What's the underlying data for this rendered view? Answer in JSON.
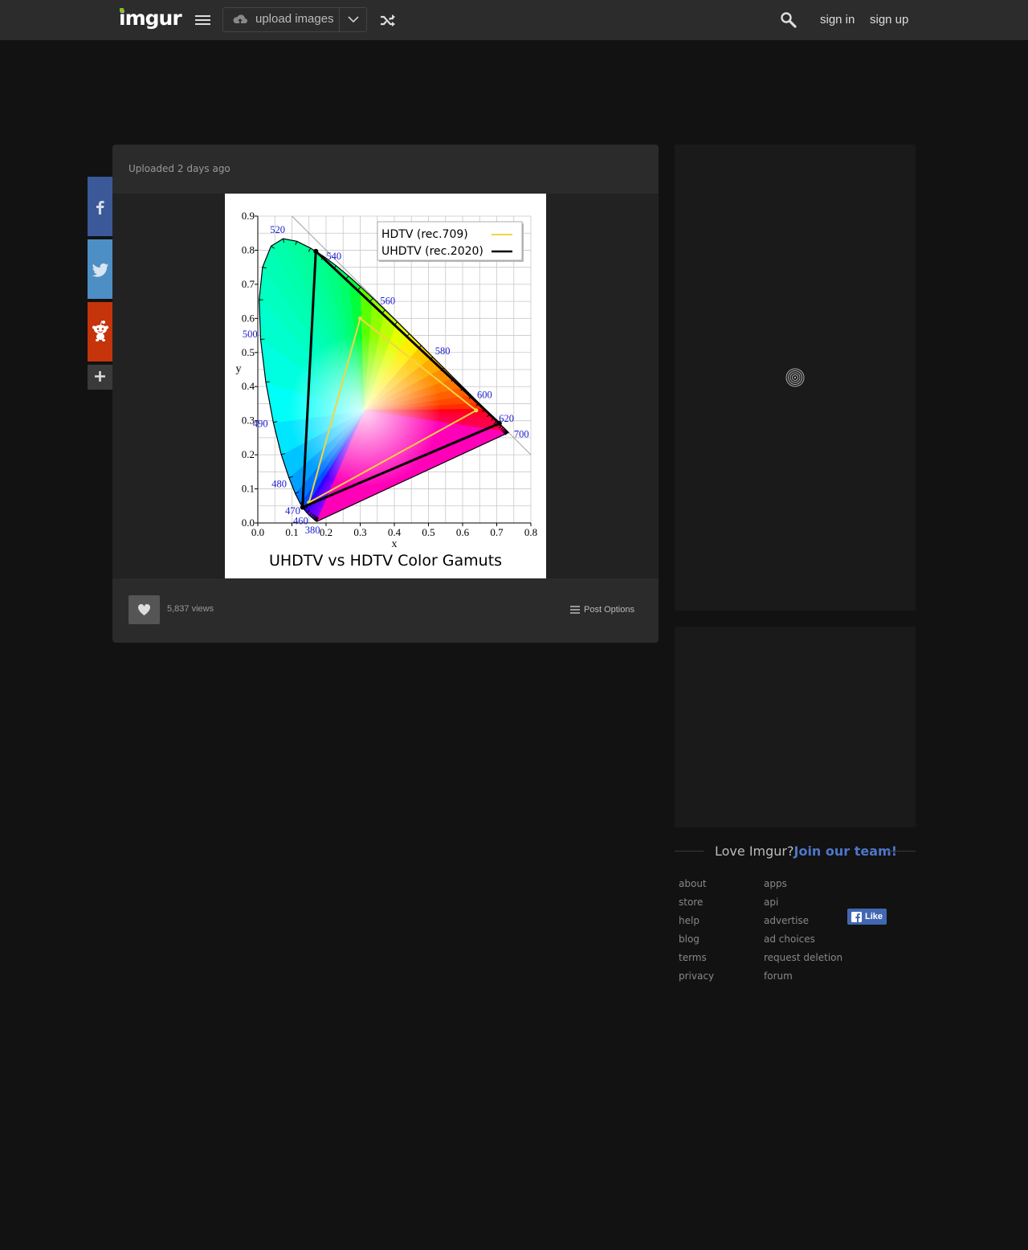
{
  "header": {
    "logo": "imgur",
    "upload_label": "upload images",
    "sign_in": "sign in",
    "sign_up": "sign up"
  },
  "post": {
    "uploaded_label": "Uploaded",
    "uploaded_time": "2 days ago",
    "views": "5,837 views",
    "post_options": "Post Options"
  },
  "chart_data": {
    "type": "scatter",
    "title": "UHDTV vs HDTV Color Gamuts",
    "xlabel": "x",
    "ylabel": "y",
    "xlim": [
      0.0,
      0.8
    ],
    "ylim": [
      0.0,
      0.9
    ],
    "xticks": [
      "0.0",
      "0.1",
      "0.2",
      "0.3",
      "0.4",
      "0.5",
      "0.6",
      "0.7",
      "0.8"
    ],
    "yticks": [
      "0.0",
      "0.1",
      "0.2",
      "0.3",
      "0.4",
      "0.5",
      "0.6",
      "0.7",
      "0.8",
      "0.9"
    ],
    "grid": true,
    "legend_position": "top-right",
    "series": [
      {
        "name": "HDTV (rec.709)",
        "color": "#f5d442",
        "x": [
          0.64,
          0.3,
          0.15,
          0.64
        ],
        "y": [
          0.33,
          0.6,
          0.06,
          0.33
        ]
      },
      {
        "name": "UHDTV (rec.2020)",
        "color": "#000000",
        "x": [
          0.708,
          0.17,
          0.131,
          0.708
        ],
        "y": [
          0.292,
          0.797,
          0.046,
          0.292
        ]
      }
    ],
    "wavelength_labels": [
      {
        "label": "380",
        "x": 0.175,
        "y": 0.005
      },
      {
        "label": "460",
        "x": 0.144,
        "y": 0.03
      },
      {
        "label": "470",
        "x": 0.124,
        "y": 0.058
      },
      {
        "label": "480",
        "x": 0.091,
        "y": 0.133
      },
      {
        "label": "490",
        "x": 0.045,
        "y": 0.295
      },
      {
        "label": "500",
        "x": 0.008,
        "y": 0.538
      },
      {
        "label": "520",
        "x": 0.074,
        "y": 0.834
      },
      {
        "label": "540",
        "x": 0.23,
        "y": 0.754
      },
      {
        "label": "560",
        "x": 0.373,
        "y": 0.624
      },
      {
        "label": "580",
        "x": 0.512,
        "y": 0.487
      },
      {
        "label": "600",
        "x": 0.627,
        "y": 0.372
      },
      {
        "label": "620",
        "x": 0.691,
        "y": 0.308
      },
      {
        "label": "700",
        "x": 0.735,
        "y": 0.265
      }
    ],
    "locus": [
      [
        0.1741,
        0.005
      ],
      [
        0.174,
        0.005
      ],
      [
        0.1738,
        0.0049
      ],
      [
        0.1736,
        0.0049
      ],
      [
        0.1733,
        0.0048
      ],
      [
        0.173,
        0.0048
      ],
      [
        0.1726,
        0.0048
      ],
      [
        0.1721,
        0.0048
      ],
      [
        0.1714,
        0.0051
      ],
      [
        0.1703,
        0.0058
      ],
      [
        0.1689,
        0.0069
      ],
      [
        0.1669,
        0.0086
      ],
      [
        0.1644,
        0.0109
      ],
      [
        0.1611,
        0.0138
      ],
      [
        0.1566,
        0.0177
      ],
      [
        0.151,
        0.0227
      ],
      [
        0.144,
        0.0297
      ],
      [
        0.1355,
        0.0399
      ],
      [
        0.1241,
        0.0578
      ],
      [
        0.1096,
        0.0868
      ],
      [
        0.0913,
        0.1327
      ],
      [
        0.0687,
        0.2007
      ],
      [
        0.0454,
        0.295
      ],
      [
        0.0235,
        0.4127
      ],
      [
        0.0082,
        0.5384
      ],
      [
        0.0039,
        0.6548
      ],
      [
        0.0139,
        0.7502
      ],
      [
        0.0389,
        0.812
      ],
      [
        0.0743,
        0.8338
      ],
      [
        0.1142,
        0.8262
      ],
      [
        0.1547,
        0.8059
      ],
      [
        0.1929,
        0.7816
      ],
      [
        0.2296,
        0.7543
      ],
      [
        0.2658,
        0.7243
      ],
      [
        0.3016,
        0.6923
      ],
      [
        0.3373,
        0.6589
      ],
      [
        0.3731,
        0.6245
      ],
      [
        0.4087,
        0.5896
      ],
      [
        0.4441,
        0.5547
      ],
      [
        0.4788,
        0.5202
      ],
      [
        0.5125,
        0.4866
      ],
      [
        0.5448,
        0.4544
      ],
      [
        0.5752,
        0.4242
      ],
      [
        0.6029,
        0.3965
      ],
      [
        0.627,
        0.3725
      ],
      [
        0.6482,
        0.3514
      ],
      [
        0.6658,
        0.334
      ],
      [
        0.6801,
        0.3197
      ],
      [
        0.6915,
        0.3083
      ],
      [
        0.7006,
        0.2993
      ],
      [
        0.7079,
        0.292
      ],
      [
        0.714,
        0.2859
      ],
      [
        0.719,
        0.2809
      ],
      [
        0.723,
        0.277
      ],
      [
        0.726,
        0.274
      ],
      [
        0.7283,
        0.2717
      ],
      [
        0.73,
        0.27
      ],
      [
        0.7311,
        0.2689
      ],
      [
        0.732,
        0.268
      ],
      [
        0.7327,
        0.2673
      ],
      [
        0.7334,
        0.2666
      ],
      [
        0.734,
        0.266
      ],
      [
        0.7344,
        0.2656
      ],
      [
        0.7346,
        0.2654
      ],
      [
        0.7347,
        0.2653
      ]
    ]
  },
  "footer": {
    "love_text": "Love Imgur?",
    "join_text": "Join our team!",
    "col1": [
      "about",
      "store",
      "help",
      "blog",
      "terms",
      "privacy"
    ],
    "col2": [
      "apps",
      "api",
      "advertise",
      "ad choices",
      "request deletion",
      "forum"
    ],
    "like_label": "Like"
  }
}
